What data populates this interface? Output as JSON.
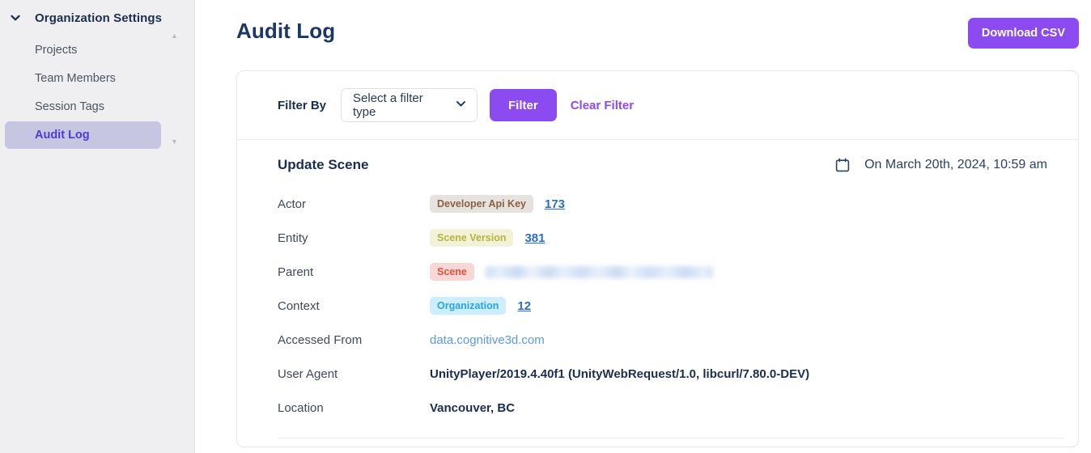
{
  "sidebar": {
    "org_title": "Organization Settings",
    "chevron_icon": "chevron-down-icon",
    "items": [
      {
        "label": "Projects",
        "active": false
      },
      {
        "label": "Team Members",
        "active": false
      },
      {
        "label": "Session Tags",
        "active": false
      },
      {
        "label": "Audit Log",
        "active": true
      }
    ],
    "scroll_up_icon": "▲",
    "scroll_down_icon": "▼"
  },
  "header": {
    "title": "Audit Log",
    "download_label": "Download CSV"
  },
  "filter": {
    "label": "Filter By",
    "select_value": "Select a filter type",
    "chevron_icon": "⌄",
    "filter_button": "Filter",
    "clear_button": "Clear Filter"
  },
  "entry": {
    "title": "Update Scene",
    "date": "On March 20th, 2024, 10:59 am",
    "calendar_icon": "calendar-icon",
    "rows": [
      {
        "label": "Actor",
        "badge": "Developer Api Key",
        "link": "173"
      },
      {
        "label": "Entity",
        "badge": "Scene Version",
        "link": "381"
      },
      {
        "label": "Parent",
        "badge": "Scene",
        "link": ""
      },
      {
        "label": "Context",
        "badge": "Organization",
        "link": "12"
      },
      {
        "label": "Accessed From",
        "value": "data.cognitive3d.com"
      },
      {
        "label": "User Agent",
        "value": "UnityPlayer/2019.4.40f1 (UnityWebRequest/1.0, libcurl/7.80.0-DEV)"
      },
      {
        "label": "Location",
        "value": "Vancouver, BC"
      }
    ]
  },
  "colors": {
    "accent_purple": "#8b4bf0",
    "sidebar_active_bg": "#c7c6e2",
    "sidebar_active_text": "#4c3bd4",
    "title_navy": "#1b3763",
    "link_blue": "#2a6fc9"
  }
}
